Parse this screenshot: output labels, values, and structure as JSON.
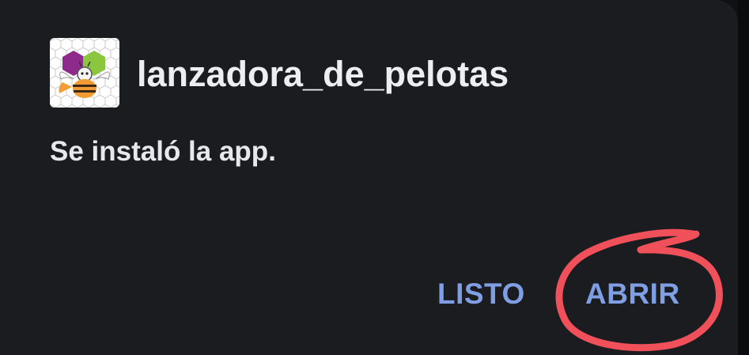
{
  "dialog": {
    "app_name": "lanzadora_de_pelotas",
    "message": "Se instaló la app.",
    "app_icon": "app-inventor-bee-icon"
  },
  "actions": {
    "done_label": "LISTO",
    "open_label": "ABRIR"
  },
  "colors": {
    "dialog_background": "#1b1c1f",
    "title_text": "#eceef1",
    "button_text": "#7f9ee3",
    "annotation_stroke": "#f0505a"
  }
}
